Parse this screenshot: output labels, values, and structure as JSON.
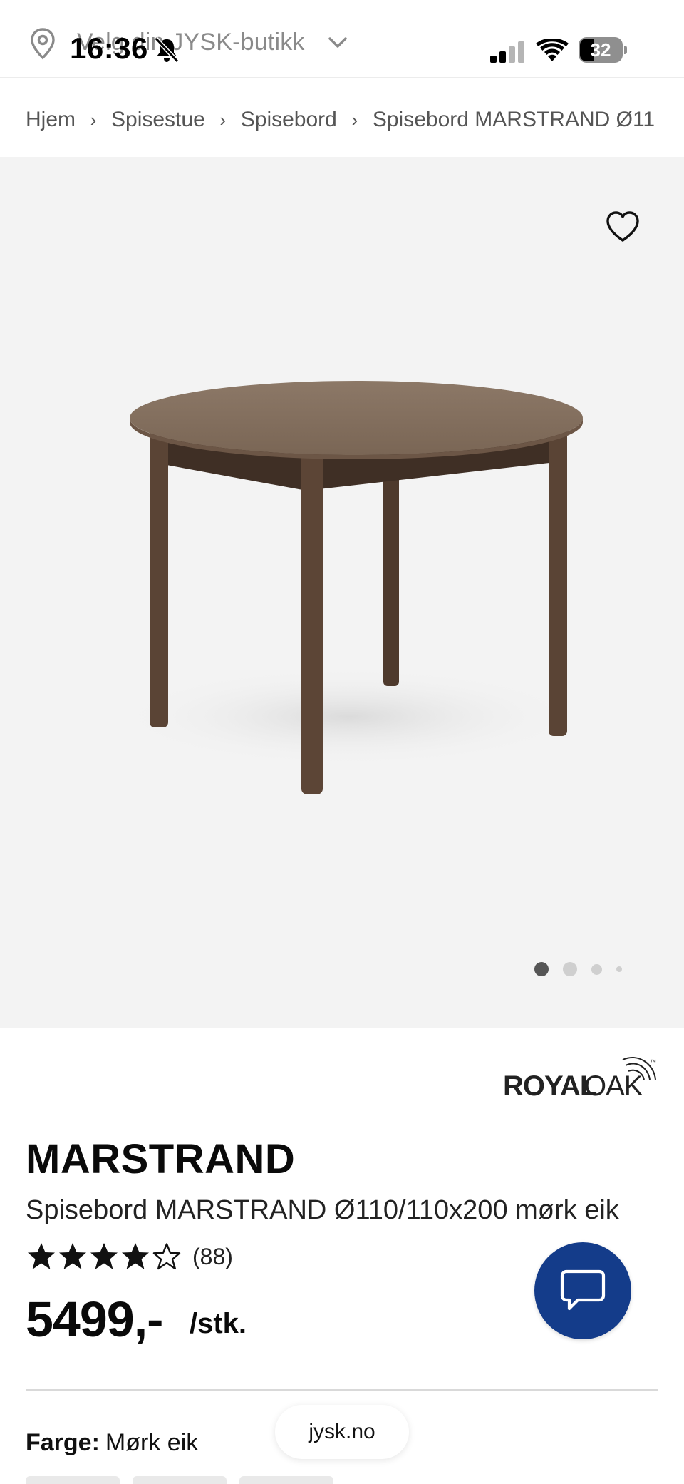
{
  "top_bar": {
    "store_label": "Velg din JYSK-butikk",
    "status": {
      "time": "16:36",
      "battery": "32"
    }
  },
  "breadcrumb": {
    "items": [
      "Hjem",
      "Spisestue",
      "Spisebord",
      "Spisebord MARSTRAND Ø11"
    ],
    "separator": "›"
  },
  "gallery": {
    "image_alt_icon": "dining-table-image",
    "slide_count": 4,
    "active_slide": 1
  },
  "brand": {
    "name_bold": "ROYAL",
    "name_light": "OAK",
    "mark": "™"
  },
  "product": {
    "name": "MARSTRAND",
    "description": "Spisebord MARSTRAND Ø110/110x200 mørk eik",
    "rating_value": 4,
    "rating_max": 5,
    "review_count": "(88)",
    "price": "5499,-",
    "unit": "/stk."
  },
  "options": {
    "color_label": "Farge:",
    "color_value": "Mørk eik"
  },
  "browser": {
    "url": "jysk.no"
  },
  "colors": {
    "chat_button": "#143c8a",
    "gallery_bg": "#f3f3f3",
    "table_wood": "#5b4536"
  }
}
